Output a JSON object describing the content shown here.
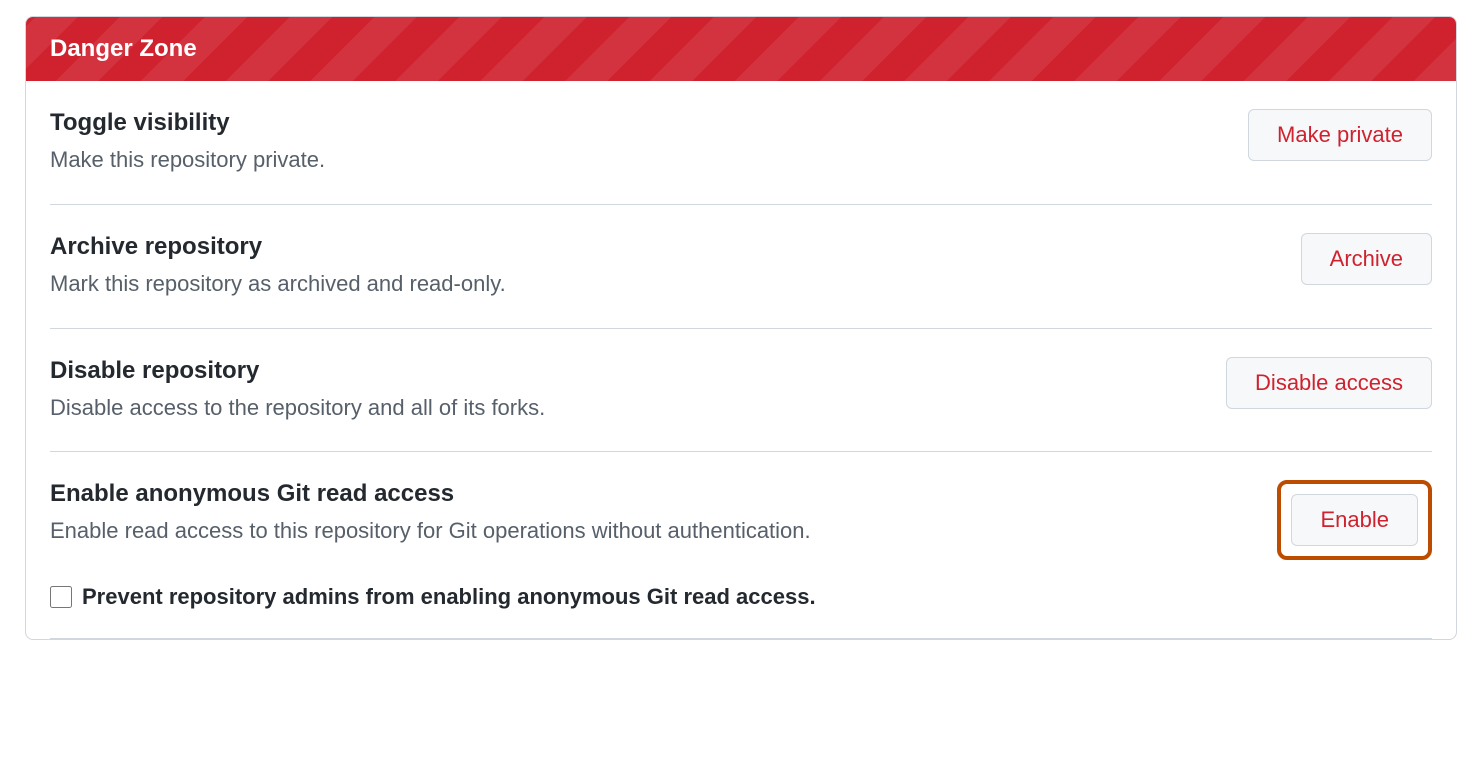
{
  "panel": {
    "header": "Danger Zone"
  },
  "items": {
    "visibility": {
      "title": "Toggle visibility",
      "desc": "Make this repository private.",
      "button": "Make private"
    },
    "archive": {
      "title": "Archive repository",
      "desc": "Mark this repository as archived and read-only.",
      "button": "Archive"
    },
    "disable": {
      "title": "Disable repository",
      "desc": "Disable access to the repository and all of its forks.",
      "button": "Disable access"
    },
    "anon": {
      "title": "Enable anonymous Git read access",
      "desc": "Enable read access to this repository for Git operations without authentication.",
      "button": "Enable",
      "checkbox_label": "Prevent repository admins from enabling anonymous Git read access."
    }
  }
}
